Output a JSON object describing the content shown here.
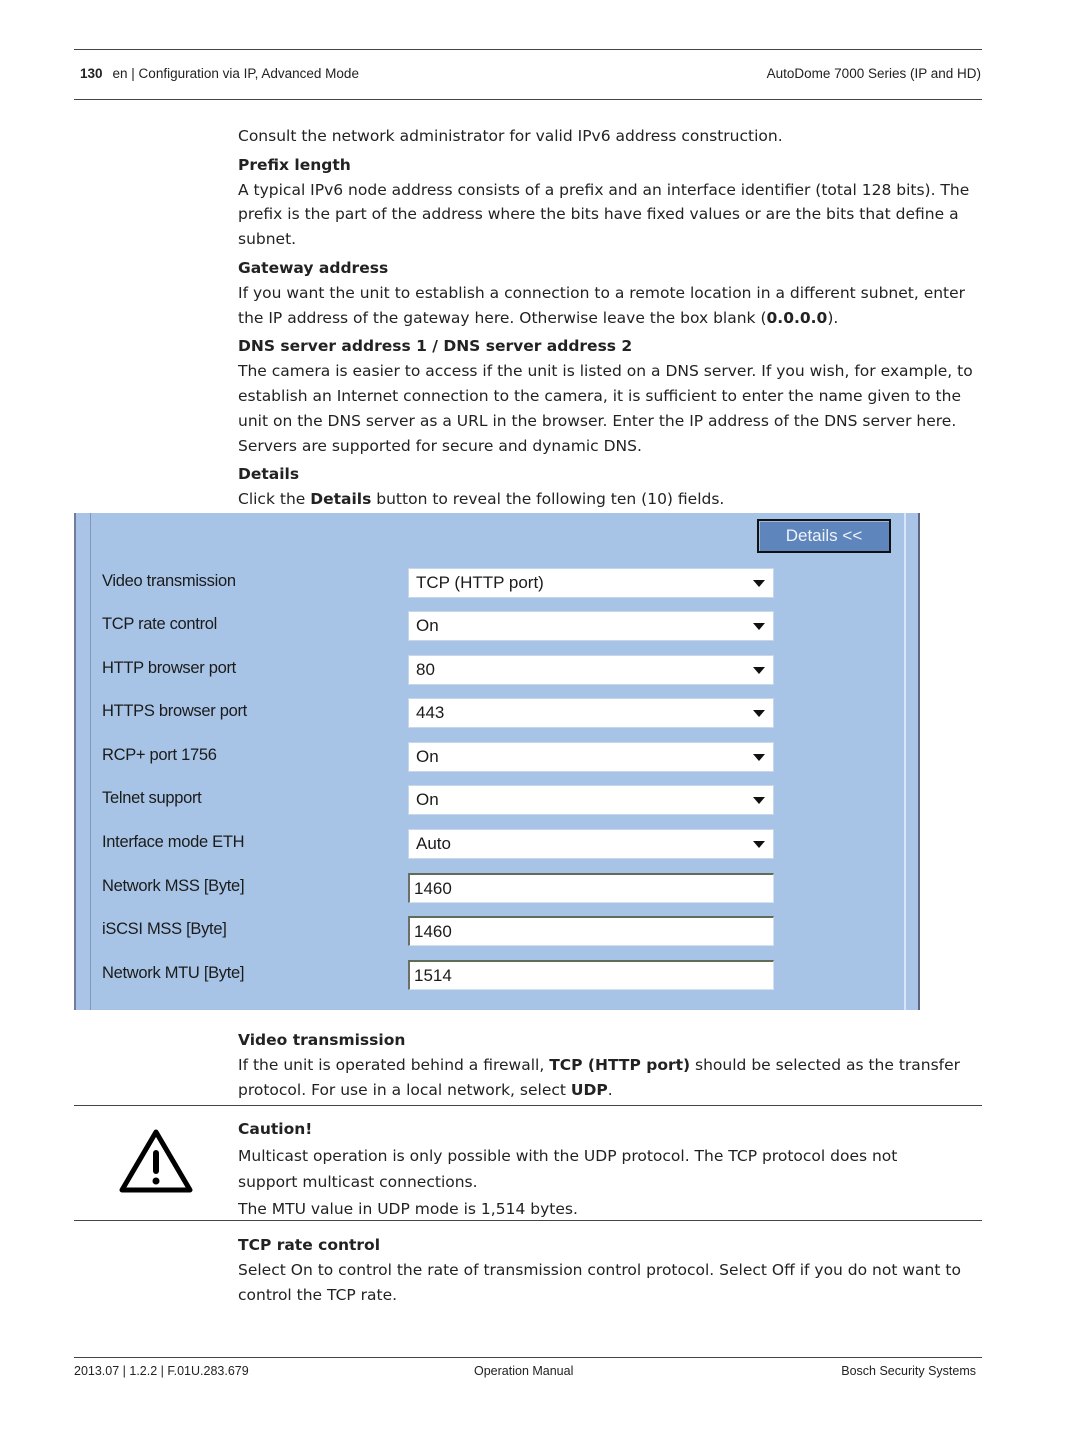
{
  "header": {
    "page_number": "130",
    "section": "en | Configuration via IP, Advanced Mode",
    "product": "AutoDome 7000 Series (IP and HD)"
  },
  "intro": "Consult the network administrator for valid IPv6 address construction.",
  "sections": {
    "prefix": {
      "heading": "Prefix length",
      "text": "A typical IPv6 node address consists of a prefix and an interface identifier (total 128 bits). The prefix is the part of the address where the bits have fixed values or are the bits that define a subnet."
    },
    "gateway": {
      "heading": "Gateway address",
      "text_before": "If you want the unit to establish a connection to a remote location in a different subnet, enter the IP address of the gateway here. Otherwise leave the box blank (",
      "bold": "0.0.0.0",
      "text_after": ")."
    },
    "dns": {
      "heading": "DNS server address 1 / DNS server address 2",
      "text": "The camera is easier to access if the unit is listed on a DNS server. If you wish, for example, to establish an Internet connection to the camera, it is sufficient to enter the name given to the unit on the DNS server as a URL in the browser. Enter the IP address of the DNS server here. Servers are supported for secure and dynamic DNS."
    },
    "details": {
      "heading": "Details",
      "text_before": "Click the ",
      "bold": "Details",
      "text_after": " button to reveal the following ten (10) fields."
    },
    "video": {
      "heading": "Video transmission",
      "text_before": "If the unit is operated behind a firewall, ",
      "bold1": "TCP (HTTP port)",
      "text_mid": " should be selected as the transfer protocol. For use in a local network, select ",
      "bold2": "UDP",
      "text_after": "."
    },
    "caution": {
      "heading": "Caution!",
      "line1": "Multicast operation is only possible with the UDP protocol. The TCP protocol does not support multicast connections.",
      "line2": "The MTU value in UDP mode is 1,514 bytes."
    },
    "tcp_rate": {
      "heading": "TCP rate control",
      "text": "Select On to control the rate of transmission control protocol. Select Off if you do not want to control the TCP rate."
    }
  },
  "panel": {
    "details_button": "Details <<",
    "fields": [
      {
        "label": "Video transmission",
        "type": "select",
        "value": "TCP (HTTP port)"
      },
      {
        "label": "TCP rate control",
        "type": "select",
        "value": "On"
      },
      {
        "label": "HTTP browser port",
        "type": "select",
        "value": "80"
      },
      {
        "label": "HTTPS browser port",
        "type": "select",
        "value": "443"
      },
      {
        "label": "RCP+ port 1756",
        "type": "select",
        "value": "On"
      },
      {
        "label": "Telnet support",
        "type": "select",
        "value": "On"
      },
      {
        "label": "Interface mode ETH",
        "type": "select",
        "value": "Auto"
      },
      {
        "label": "Network MSS [Byte]",
        "type": "text",
        "value": "1460"
      },
      {
        "label": "iSCSI MSS [Byte]",
        "type": "text",
        "value": "1460"
      },
      {
        "label": "Network MTU [Byte]",
        "type": "text",
        "value": "1514"
      }
    ]
  },
  "footer": {
    "doc_id": "2013.07 | 1.2.2 | F.01U.283.679",
    "doc_type": "Operation Manual",
    "company": "Bosch Security Systems"
  }
}
